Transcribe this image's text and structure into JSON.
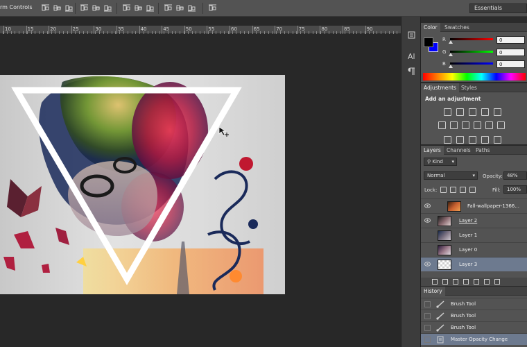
{
  "options_bar": {
    "label": "rm Controls"
  },
  "workspace": {
    "value": "Essentials"
  },
  "ruler": {
    "marks": [
      "10",
      "15",
      "20",
      "25",
      "30",
      "35",
      "40",
      "45",
      "50",
      "55",
      "60",
      "65",
      "70",
      "75",
      "80",
      "85",
      "90"
    ]
  },
  "color_panel": {
    "tabs": [
      "Color",
      "Swatches"
    ],
    "channels": [
      {
        "label": "R",
        "value": "0",
        "color": "#ff0000"
      },
      {
        "label": "G",
        "value": "0",
        "color": "#00ff00"
      },
      {
        "label": "B",
        "value": "0",
        "color": "#0000ff"
      }
    ],
    "foreground": "#000000",
    "background": "#0000ff"
  },
  "adjustments_panel": {
    "tabs": [
      "Adjustments",
      "Styles"
    ],
    "title": "Add an adjustment"
  },
  "layers_panel": {
    "tabs": [
      "Layers",
      "Channels",
      "Paths"
    ],
    "filter": "Kind",
    "blend_mode": "Normal",
    "opacity_label": "Opacity:",
    "opacity_value": "48%",
    "lock_label": "Lock:",
    "fill_label": "Fill:",
    "fill_value": "100%",
    "layers": [
      {
        "name": "Fall-wallpaper-1366...",
        "visible": true,
        "selected": false
      },
      {
        "name": "Layer 2",
        "visible": true,
        "selected": false
      },
      {
        "name": "Layer 1",
        "visible": false,
        "selected": false
      },
      {
        "name": "Layer 0",
        "visible": false,
        "selected": false
      },
      {
        "name": "Layer 3",
        "visible": true,
        "selected": true
      }
    ]
  },
  "history_panel": {
    "tabs": [
      "History"
    ],
    "items": [
      {
        "name": "Brush Tool",
        "selected": false
      },
      {
        "name": "Brush Tool",
        "selected": false
      },
      {
        "name": "Brush Tool",
        "selected": false
      },
      {
        "name": "Master Opacity Change",
        "selected": true
      }
    ]
  }
}
